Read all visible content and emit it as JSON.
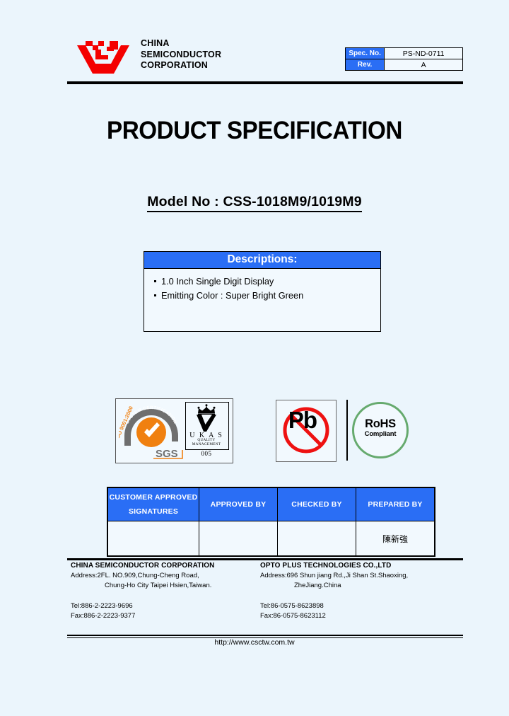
{
  "header": {
    "logo_icon": "csc-logo-icon",
    "company_name": "CHINA\nSEMICONDUCTOR\nCORPORATION",
    "spec_table": {
      "spec_no_label": "Spec. No.",
      "spec_no_value": "PS-ND-0711",
      "rev_label": "Rev.",
      "rev_value": "A"
    }
  },
  "title": "PRODUCT SPECIFICATION",
  "model": "Model No : CSS-1018M9/1019M9",
  "descriptions": {
    "heading": "Descriptions:",
    "items": [
      "1.0 Inch Single Digit Display",
      "Emitting Color : Super Bright Green"
    ]
  },
  "certifications": {
    "sgs": {
      "arc_text": "SYSTEM CERTIFICATION",
      "iso_text": "ISO 9001:2000",
      "brand": "SGS"
    },
    "ukas": {
      "name": "U K A S",
      "sub_line1": "QUALITY",
      "sub_line2": "MANAGEMENT",
      "number": "005"
    },
    "pb": {
      "label": "Pb"
    },
    "rohs": {
      "main": "RoHS",
      "sub": "Compliant"
    }
  },
  "signature_table": {
    "headers": [
      "CUSTOMER APPROVED SIGNATURES",
      "APPROVED BY",
      "CHECKED BY",
      "PREPARED BY"
    ],
    "header_line1": "CUSTOMER APPROVED",
    "header_line2": "SIGNATURES",
    "values": [
      "",
      "",
      "",
      "陳新強"
    ]
  },
  "footer": {
    "left": {
      "company": "CHINA SEMICONDUCTOR CORPORATION",
      "address_line1": "Address:2FL. NO.909,Chung-Cheng Road,",
      "address_line2": "Chung-Ho City Taipei Hsien,Taiwan.",
      "tel": "Tel:886-2-2223-9696",
      "fax": "Fax:886-2-2223-9377"
    },
    "right": {
      "company": "OPTO PLUS TECHNOLOGIES CO.,LTD",
      "address_line1": "Address:696 Shun jiang Rd.,Ji Shan St.Shaoxing,",
      "address_line2": "ZheJiang.China",
      "tel": "Tel:86-0575-8623898",
      "fax": "Fax:86-0575-8623112"
    },
    "website": "http://www.csctw.com.tw"
  },
  "colors": {
    "page_bg": "#ebf5fc",
    "accent_blue": "#2a6ef5",
    "logo_red": "#f40000",
    "sgs_orange": "#f08010",
    "sgs_gray": "#6f6f6f",
    "rohs_green": "#66aa6e",
    "pb_red": "#ee1111"
  }
}
